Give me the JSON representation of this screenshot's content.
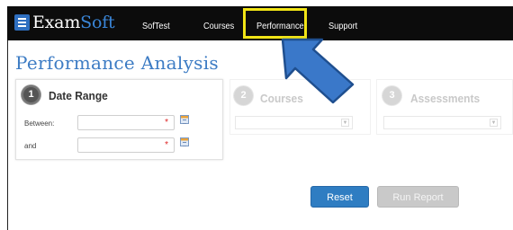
{
  "nav": {
    "logo_main": "Exam",
    "logo_accent": "Soft",
    "items": [
      {
        "label": "SofTest"
      },
      {
        "label": "Courses"
      },
      {
        "label": "Performance"
      },
      {
        "label": "Support"
      }
    ],
    "active_item": "Performance"
  },
  "page": {
    "title": "Performance Analysis"
  },
  "steps": {
    "date_range": {
      "number": "1",
      "title": "Date Range",
      "between_label": "Between:",
      "and_label": "and",
      "between_value": "",
      "and_value": "",
      "required_mark": "*"
    },
    "courses": {
      "number": "2",
      "title": "Courses",
      "select_value": ""
    },
    "assessments": {
      "number": "3",
      "title": "Assessments",
      "select_value": ""
    }
  },
  "buttons": {
    "reset": "Reset",
    "run_report": "Run Report"
  },
  "colors": {
    "nav_bg": "#0c0c0c",
    "accent_blue": "#3d7cc4",
    "highlight_yellow": "#f1e416",
    "arrow_blue": "#3a78c9",
    "disabled_gray": "#c9c9c9"
  },
  "icons": {
    "logo": "menu-lines-icon",
    "calendar": "calendar-icon",
    "select_arrow": "dropdown-arrow-icon",
    "annotation": "pointer-arrow-icon"
  }
}
